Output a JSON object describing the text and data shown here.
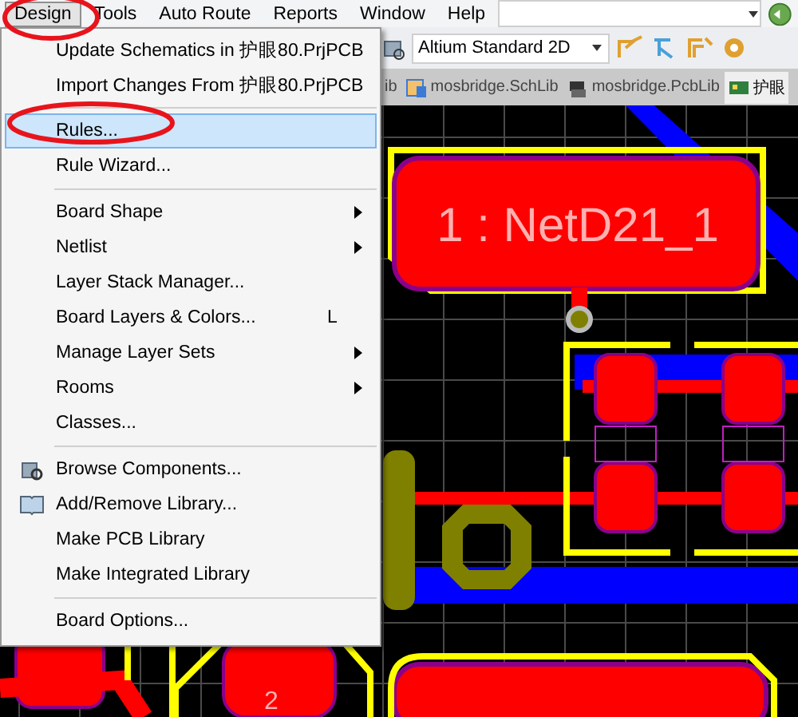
{
  "menu_bar": {
    "items": [
      {
        "label": "Design",
        "selected": true
      },
      {
        "label": "Tools",
        "selected": false
      },
      {
        "label": "Auto Route",
        "selected": false
      },
      {
        "label": "Reports",
        "selected": false
      },
      {
        "label": "Window",
        "selected": false
      },
      {
        "label": "Help",
        "selected": false
      }
    ]
  },
  "toolbar": {
    "view_mode": "Altium Standard 2D"
  },
  "document_tabs": [
    {
      "label": "ib",
      "kind": "generic",
      "selected": false
    },
    {
      "label": "mosbridge.SchLib",
      "kind": "schlib",
      "selected": false
    },
    {
      "label": "mosbridge.PcbLib",
      "kind": "pcblib",
      "selected": false
    },
    {
      "label": "护眼",
      "kind": "pcb",
      "selected": true
    }
  ],
  "canvas": {
    "pad_labels": [
      "1 : NetD21_1",
      "2"
    ]
  },
  "design_menu": {
    "items": [
      {
        "kind": "item",
        "label": "Update Schematics in 护眼80.PrjPCB",
        "selected": false
      },
      {
        "kind": "item",
        "label": "Import Changes From 护眼80.PrjPCB",
        "selected": false
      },
      {
        "kind": "separator"
      },
      {
        "kind": "item",
        "label": "Rules...",
        "selected": true
      },
      {
        "kind": "item",
        "label": "Rule Wizard...",
        "selected": false
      },
      {
        "kind": "separator"
      },
      {
        "kind": "item",
        "label": "Board Shape",
        "selected": false,
        "submenu": true
      },
      {
        "kind": "item",
        "label": "Netlist",
        "selected": false,
        "submenu": true
      },
      {
        "kind": "item",
        "label": "Layer Stack Manager...",
        "selected": false
      },
      {
        "kind": "item",
        "label": "Board Layers & Colors...",
        "selected": false,
        "shortcut": "L"
      },
      {
        "kind": "item",
        "label": "Manage Layer Sets",
        "selected": false,
        "submenu": true
      },
      {
        "kind": "item",
        "label": "Rooms",
        "selected": false,
        "submenu": true
      },
      {
        "kind": "item",
        "label": "Classes...",
        "selected": false
      },
      {
        "kind": "separator"
      },
      {
        "kind": "browse",
        "label": "Browse Components...",
        "selected": false
      },
      {
        "kind": "library",
        "label": "Add/Remove Library...",
        "selected": false
      },
      {
        "kind": "item",
        "label": "Make PCB Library",
        "selected": false
      },
      {
        "kind": "item",
        "label": "Make Integrated Library",
        "selected": false
      },
      {
        "kind": "separator"
      },
      {
        "kind": "item",
        "label": "Board Options...",
        "selected": false
      }
    ]
  }
}
